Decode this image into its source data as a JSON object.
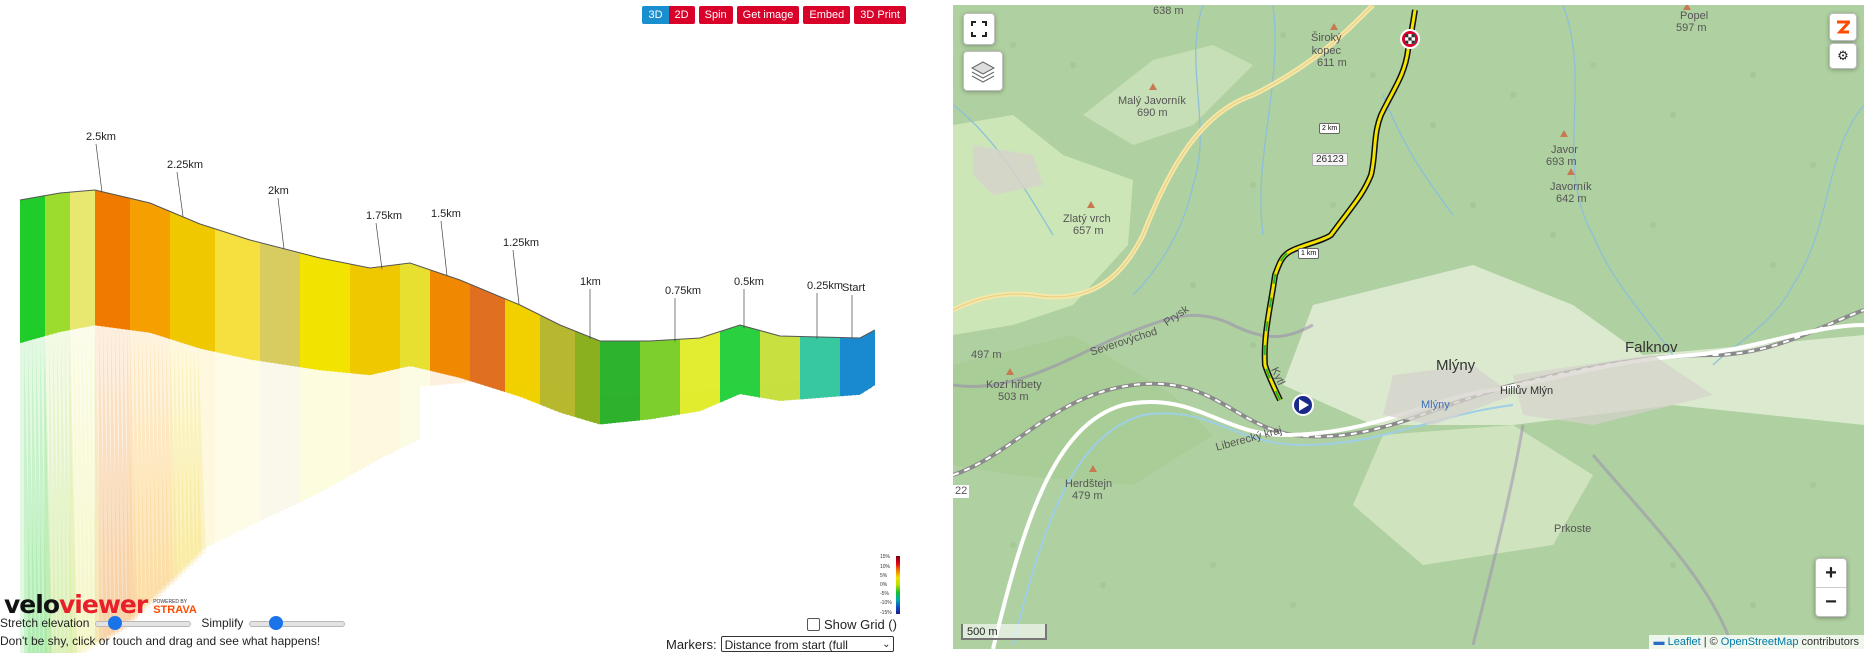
{
  "toolbar": {
    "view_3d": "3D",
    "view_2d": "2D",
    "spin": "Spin",
    "get_image": "Get image",
    "embed": "Embed",
    "print_3d": "3D Print"
  },
  "profile": {
    "distance_labels": [
      "2.5km",
      "2.25km",
      "2km",
      "1.75km",
      "1.5km",
      "1.25km",
      "1km",
      "0.75km",
      "0.5km",
      "0.25km",
      "Start"
    ],
    "gradient_legend": [
      "15%",
      "10%",
      "5%",
      "0%",
      "-5%",
      "-10%",
      "-15%"
    ],
    "accent_colors": {
      "button_red": "#d9002a",
      "button_blue": "#1a8fd0",
      "slider_blue": "#1a73e8"
    }
  },
  "branding": {
    "logo_velo": "velo",
    "logo_viewer": "viewer",
    "powered_by": "POWERED BY",
    "strava": "STRAVA"
  },
  "controls": {
    "stretch_label": "Stretch elevation",
    "stretch_value": 0.15,
    "simplify_label": "Simplify",
    "simplify_value": 0.24,
    "show_grid_label": "Show Grid ()",
    "show_grid_checked": false,
    "hint": "Don't be shy, click or touch and drag and see what happens!",
    "markers_label": "Markers:",
    "markers_value": "Distance from start (full"
  },
  "map": {
    "peaks": [
      {
        "name": "Široký\nkopec",
        "elev": "611 m"
      },
      {
        "name": "Malý Javorník",
        "elev": "690 m"
      },
      {
        "name": "Javor",
        "elev": "693 m"
      },
      {
        "name": "Javorník",
        "elev": "642 m"
      },
      {
        "name": "Zlatý vrch",
        "elev": "657 m"
      },
      {
        "name": "Kozí hřbety",
        "elev": "503 m"
      },
      {
        "name": "Herdštejn",
        "elev": "479 m"
      },
      {
        "name": "Popel",
        "elev": "597 m"
      }
    ],
    "top_elev": "638 m",
    "elev_497": "497 m",
    "places": {
      "mlyny": "Mlýny",
      "mlyny_blue": "Mlýny",
      "hilluv_mlyn": "Hillův Mlýn",
      "falknov": "Falknov",
      "prokoste": "Prkoste"
    },
    "roads": {
      "road_num": "26123",
      "severovychod": "Severovýchod",
      "prysk": "Prysk",
      "kyt": "Kytl",
      "liberecky_kraj": "Liberecký kraj",
      "road_22": "22"
    },
    "km_markers": [
      "2 km",
      "1 km"
    ],
    "scale": "500 m",
    "zoom_in": "+",
    "zoom_out": "−",
    "attribution_leaflet": "Leaflet",
    "attribution_sep": "| ©",
    "attribution_osm": "OpenStreetMap",
    "attribution_tail": "contributors",
    "route_color": "#f2e400"
  }
}
